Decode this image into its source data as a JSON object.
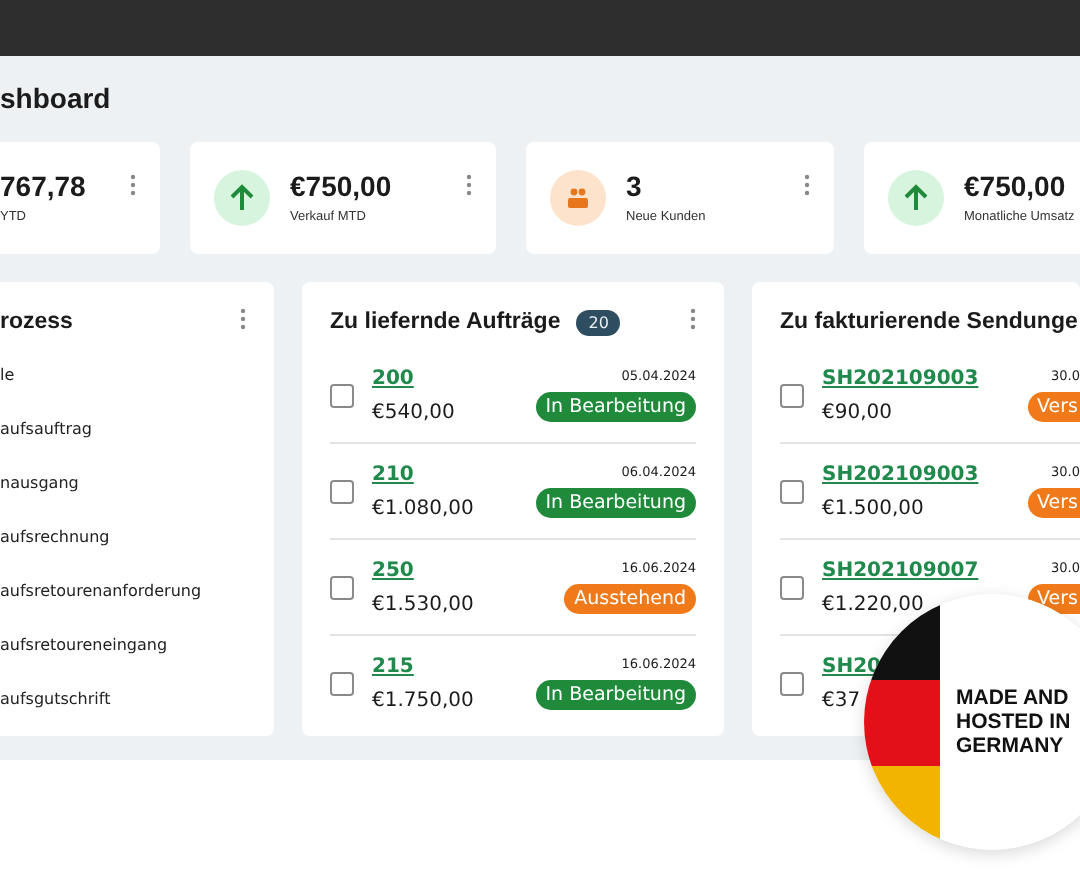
{
  "page_title": "shboard",
  "stats": [
    {
      "value": "767,78",
      "label": "YTD",
      "has_menu": true
    },
    {
      "kind": "trend",
      "value": "€750,00",
      "label": "Verkauf MTD",
      "has_menu": true
    },
    {
      "kind": "customers",
      "value": "3",
      "label": "Neue Kunden",
      "has_menu": true
    },
    {
      "kind": "trend",
      "value": "€750,00",
      "label": "Monatliche Umsatz",
      "has_menu": false
    }
  ],
  "process": {
    "title": "rozess",
    "has_menu": true,
    "items": [
      "le",
      "aufsauftrag",
      "nausgang",
      "aufsrechnung",
      "aufsretourenanforderung",
      "aufsretoureneingang",
      "aufsgutschrift"
    ]
  },
  "orders": {
    "title": "Zu liefernde Aufträge",
    "count": "20",
    "has_menu": true,
    "rows": [
      {
        "checked": false,
        "number": "200",
        "amount": "€540,00",
        "date": "05.04.2024",
        "status": {
          "label": "In Bearbeitung",
          "kind": "in-progress"
        }
      },
      {
        "checked": false,
        "number": "210",
        "amount": "€1.080,00",
        "date": "06.04.2024",
        "status": {
          "label": "In Bearbeitung",
          "kind": "in-progress"
        }
      },
      {
        "checked": false,
        "number": "250",
        "amount": "€1.530,00",
        "date": "16.06.2024",
        "status": {
          "label": "Ausstehend",
          "kind": "pending"
        }
      },
      {
        "checked": false,
        "number": "215",
        "amount": "€1.750,00",
        "date": "16.06.2024",
        "status": {
          "label": "In Bearbeitung",
          "kind": "in-progress"
        }
      }
    ]
  },
  "shipments": {
    "title": "Zu fakturierende Sendunge",
    "rows": [
      {
        "checked": false,
        "number": "SH202109003",
        "amount": "€90,00",
        "date": "30.0",
        "status": {
          "label": "Vers",
          "kind": "pending"
        }
      },
      {
        "checked": false,
        "number": "SH202109003",
        "amount": "€1.500,00",
        "date": "30.0",
        "status": {
          "label": "Vers",
          "kind": "pending"
        }
      },
      {
        "checked": false,
        "number": "SH202109007",
        "amount": "€1.220,00",
        "date": "30.0",
        "status": {
          "label": "Vers",
          "kind": "pending"
        }
      },
      {
        "checked": false,
        "number": "SH20",
        "amount": "€37"
      }
    ]
  },
  "seal": {
    "lines": [
      "MADE AND",
      "HOSTED IN",
      "GERMANY"
    ]
  }
}
